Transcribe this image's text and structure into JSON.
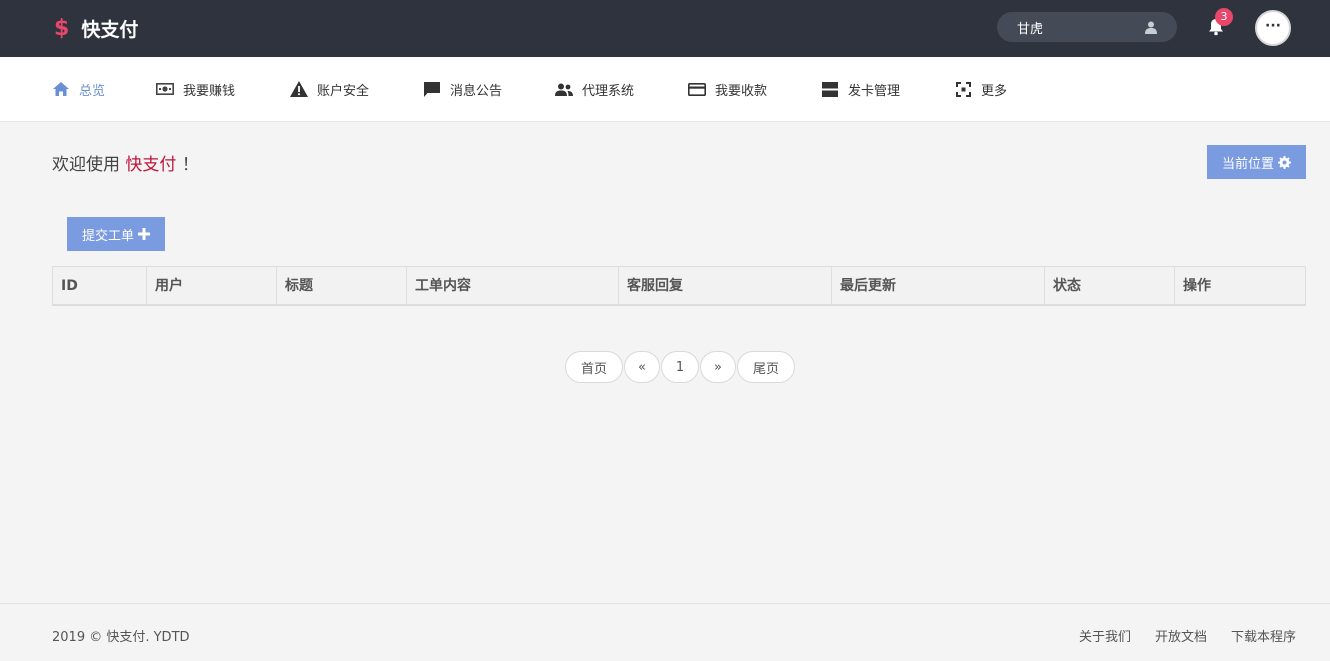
{
  "header": {
    "brand_icon": "$",
    "brand_name": "快支付",
    "username": "甘虎",
    "notification_count": "3",
    "more_label": "···"
  },
  "nav": {
    "items": [
      {
        "label": "总览",
        "icon": "home-icon"
      },
      {
        "label": "我要赚钱",
        "icon": "money-icon"
      },
      {
        "label": "账户安全",
        "icon": "warning-icon"
      },
      {
        "label": "消息公告",
        "icon": "message-icon"
      },
      {
        "label": "代理系统",
        "icon": "users-icon"
      },
      {
        "label": "我要收款",
        "icon": "card-icon"
      },
      {
        "label": "发卡管理",
        "icon": "storage-icon"
      },
      {
        "label": "更多",
        "icon": "expand-icon"
      }
    ],
    "accent_color": "#6b8fd5"
  },
  "main": {
    "welcome_prefix": "欢迎使用",
    "welcome_brand": "快支付",
    "welcome_suffix": "！",
    "location_button": "当前位置",
    "submit_ticket_button": "提交工单",
    "table": {
      "columns": [
        "ID",
        "用户",
        "标题",
        "工单内容",
        "客服回复",
        "最后更新",
        "状态",
        "操作"
      ],
      "rows": []
    },
    "pagination": {
      "first": "首页",
      "prev": "«",
      "current": "1",
      "next": "»",
      "last": "尾页"
    }
  },
  "footer": {
    "copyright": "2019 © 快支付. YDTD",
    "links": [
      "关于我们",
      "开放文档",
      "下载本程序"
    ]
  },
  "colors": {
    "topbar": "#2e333d",
    "brand_accent": "#e9466b",
    "button": "#7b9be0"
  }
}
